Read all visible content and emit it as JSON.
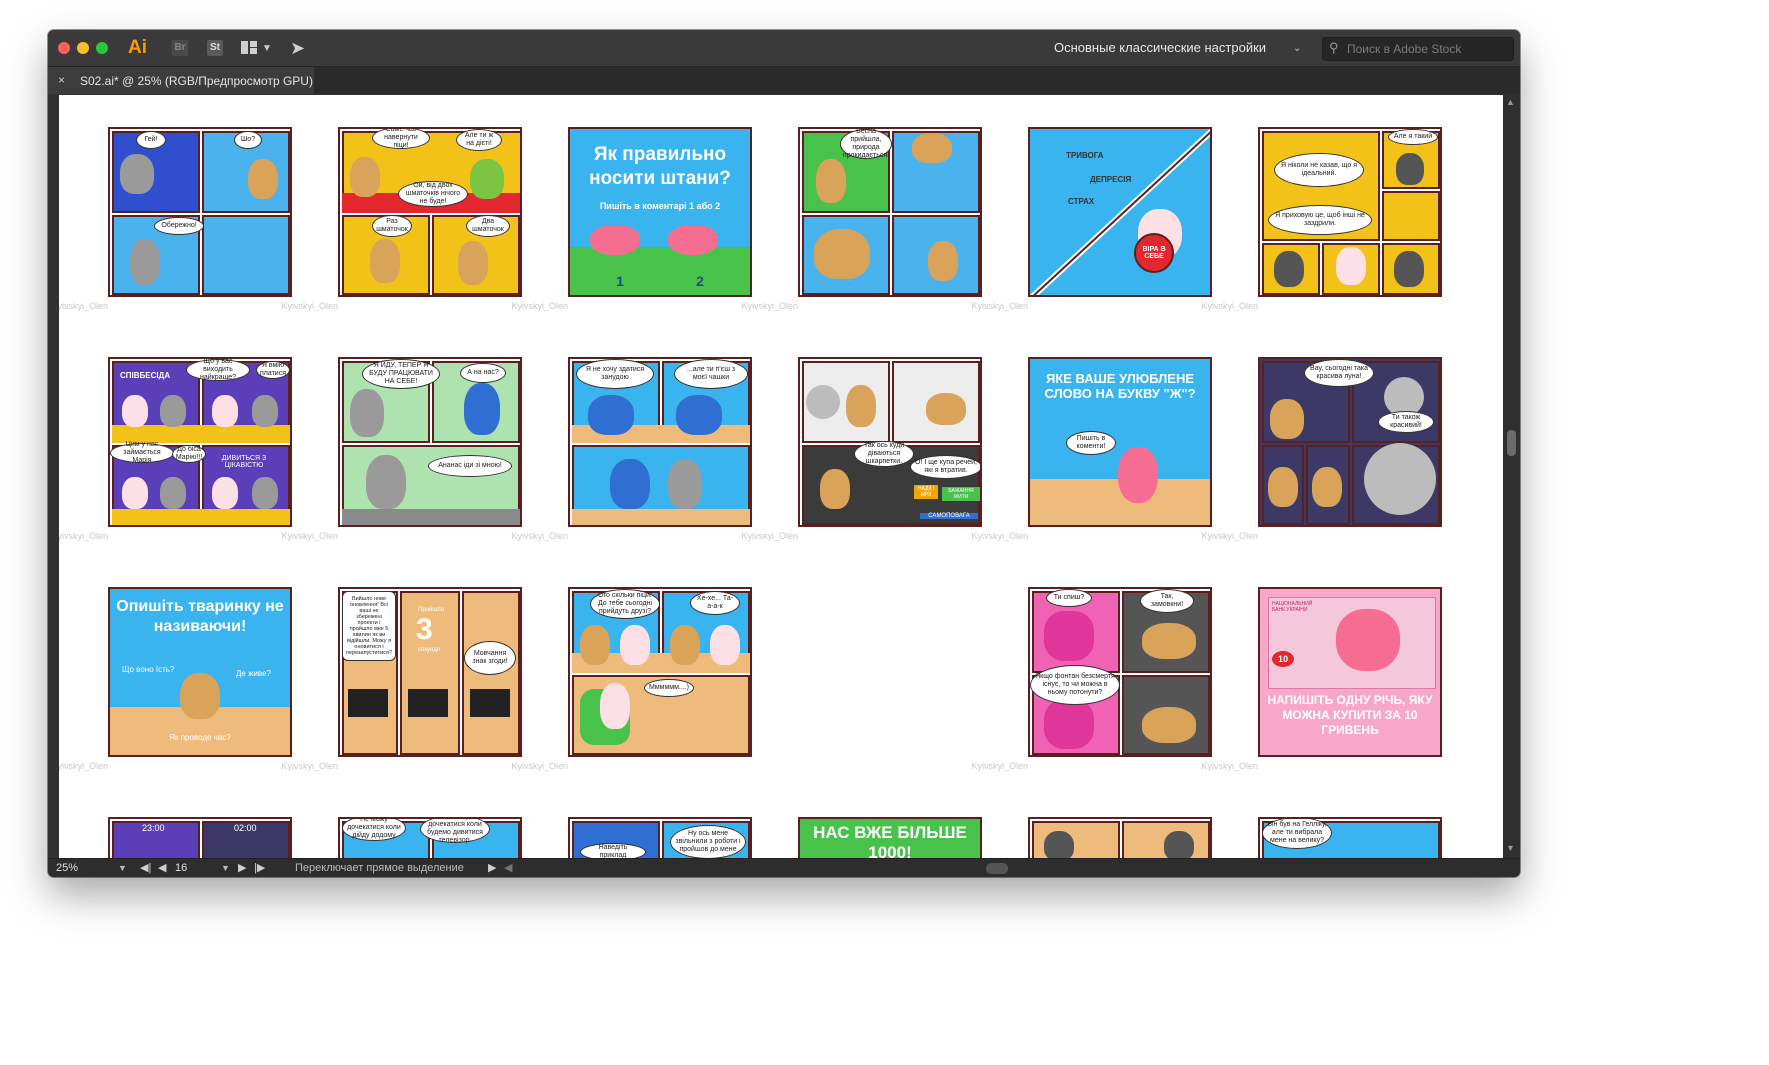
{
  "app": {
    "logo": "Ai",
    "bridge": "Br",
    "stock": "St",
    "workspace": "Основные классические настройки",
    "search_placeholder": "Поиск в Adobe Stock",
    "icons": [
      "arrange-documents-icon",
      "send-icon",
      "search-icon"
    ]
  },
  "tab": {
    "close": "×",
    "label": "S02.ai* @ 25% (RGB/Предпросмотр GPU)"
  },
  "status": {
    "zoom": "25%",
    "page": "16",
    "hint": "Переключает прямое выделение"
  },
  "credit": "Kyivskyi_Olen",
  "comics": {
    "c1": {
      "b1": "Гей!",
      "b2": "Шо?",
      "b3": "Обережно!"
    },
    "c2": {
      "b1": "Саме час наверну­ти піци!",
      "b2": "Але ти ж на дієті!",
      "b3": "Ой, від двох шматочків нічого не буде!",
      "b4": "Раз шматочок",
      "b5": "Два шматочок"
    },
    "c3": {
      "title": "Як правильно носити штани?",
      "sub": "Пишіть в коментарі 1 або 2",
      "n1": "1",
      "n2": "2"
    },
    "c4": {
      "b1": "Весна прийшла, природа прокидається!"
    },
    "c5": {
      "l1": "ТРИВОГА",
      "l2": "ДЕПРЕСІЯ",
      "l3": "СТРАХ",
      "shield": "ВІРА В СЕБЕ"
    },
    "c6": {
      "b1": "Але я такий",
      "b2": "Я ніколи не казав, що я ідеальний.",
      "b3": "Я приховую це, щоб інші не заздрили."
    },
    "c7": {
      "sign": "СПІВБЕСІДА",
      "b1": "Що у вас виходить найкраще?",
      "b2": "Я вмію платися",
      "b3": "Цим у нас займається Марія",
      "b4": "До біса Марію!!!",
      "b5": "ДИВИТЬСЯ З ЦІКАВІСТЮ"
    },
    "c8": {
      "b1": "Я ЙДУ, ТЕПЕР Я БУДУ ПРАЦЮВАТИ НА СЕБЕ!",
      "b2": "А на нас?",
      "b3": "Ананас іди зі мною!"
    },
    "c9": {
      "b1": "Я не хочу здатися занудою",
      "b2": "...але ти п'єш з моєї чашки"
    },
    "c10": {
      "b1": "Так ось куди діваються шкарпетки.",
      "b2": "О! І ще купа речей, які я втратив.",
      "t1": "НАДІЇ І МРІЇ",
      "t2": "БАЖАННЯ ЖИТИ",
      "t3": "САМОПОВАГА"
    },
    "c11": {
      "title": "ЯКЕ ВАШЕ УЛЮБЛЕНЕ СЛОВО НА БУКВУ \"Ж\"?",
      "b1": "Пишіть в коменти!"
    },
    "c12": {
      "b1": "Вау, сьогодні така красива луна!",
      "b2": "Ти також красивий!"
    },
    "c13": {
      "title": "Опишіть тваринку не називаючи!",
      "q1": "Що воно їсть?",
      "q2": "Де живе?",
      "q3": "Як проводе час?"
    },
    "c14": {
      "b1": "Вийшло нове оновлення! Всі ваші не збережені проекти і пройшло вже 5 хвилин як ви відійшли. Можу я оновитися і перезапуститися?",
      "sign1": "Пройшло",
      "num": "3",
      "sign2": "секунди",
      "b2": "Мовчання знак згоди!"
    },
    "c15": {
      "b1": "Ого скільки піци! До тебе сьогодні прийдуть друзі?",
      "b2": "Хе-хе... Та-а-а-к",
      "b3": "Мммммм....)"
    },
    "c16": {
      "b1": "Ти спиш?",
      "b2": "Так, замовкни!",
      "b3": "Якщо фонтан безсмертя існує, то чи можна в ньому потонути?"
    },
    "c17": {
      "bank": "НАЦІОНАЛЬНИЙ БАНК УКРАЇНИ",
      "note": "10",
      "title": "НАПИШІТЬ ОДНУ РІЧЬ, ЯКУ МОЖНА КУПИТИ ЗА 10 ГРИВЕНЬ"
    },
    "r4": {
      "t1": "23:00",
      "t2": "02:00",
      "b1": "Не можу дочекатися коли дійду додому",
      "b2": "Не можу дочекатися коли будемо дивитися телевізор.",
      "b3": "Наведіть приклад",
      "b4": "Ну ось мене звільнили з роботи і пройшов до мене",
      "banner": "НАС ВЖЕ БІЛЬШЕ 1000!",
      "b5": "Він був на Гелліку, але ти вибрала мене на велику?"
    }
  }
}
